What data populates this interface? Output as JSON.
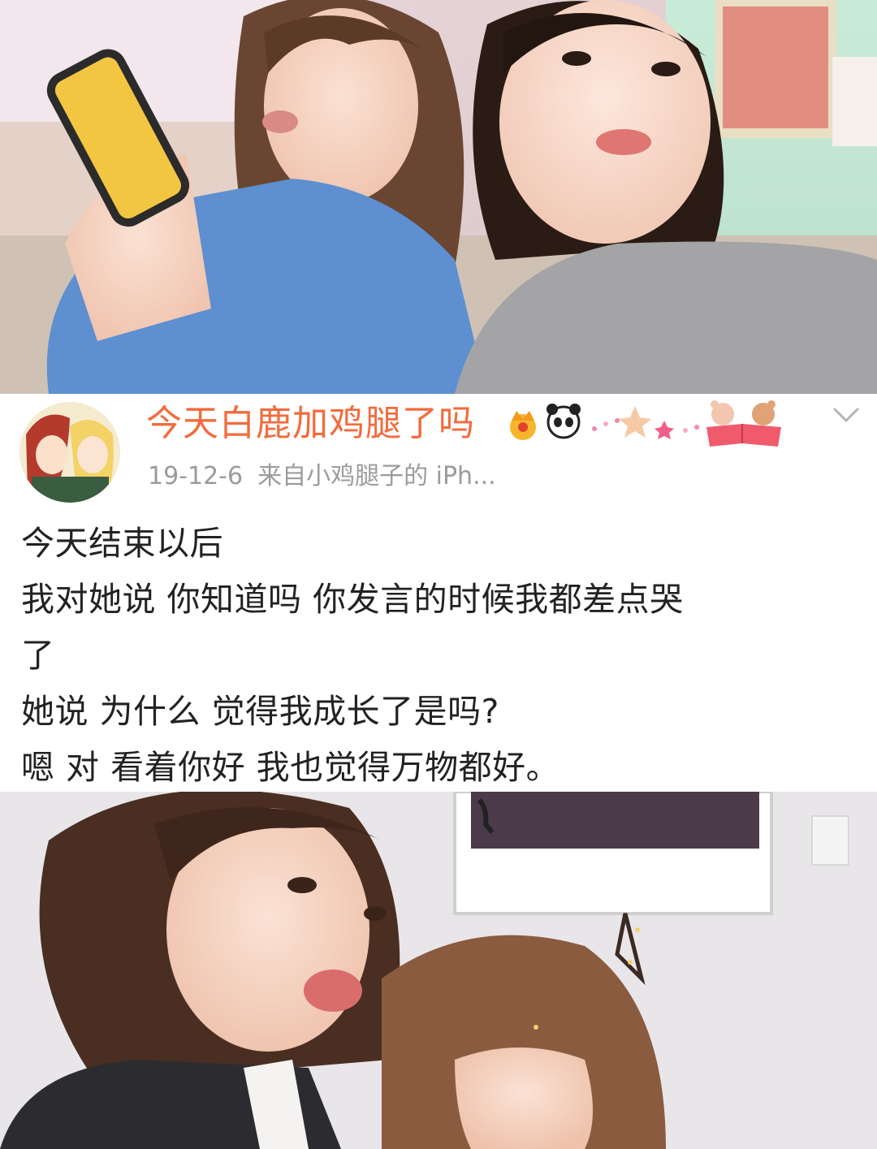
{
  "post": {
    "username": "今天白鹿加鸡腿了吗",
    "date": "19-12-6",
    "source": "来自小鸡腿子的 iPh...",
    "lines": [
      "今天结束以后",
      "我对她说 你知道吗 你发言的时候我都差点哭",
      "了",
      "她说 为什么 觉得我成长了是吗?",
      "嗯 对 看着你好 我也觉得万物都好。"
    ]
  },
  "icons": {
    "badge": "crown-vip-icon",
    "decoration": "panda-star-bear-sticker-icon",
    "menu": "chevron-down-icon"
  },
  "colors": {
    "username": "#f36b3d",
    "meta": "#9b9b9b",
    "body_text": "#222222",
    "background": "#ffffff"
  }
}
